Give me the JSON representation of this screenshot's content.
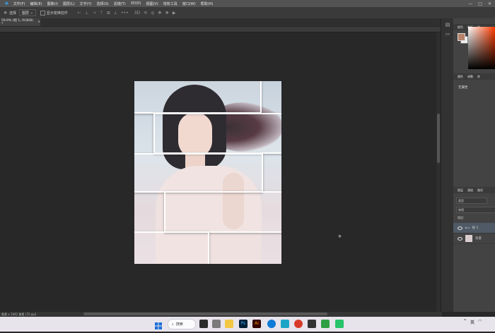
{
  "menu": {
    "items": [
      "文件(F)",
      "编辑(E)",
      "图像(I)",
      "图层(L)",
      "文字(Y)",
      "选择(S)",
      "滤镜(T)",
      "3D(D)",
      "视图(V)",
      "增效工具",
      "窗口(W)",
      "帮助(H)"
    ],
    "window_controls": [
      "—",
      "□",
      "✕"
    ]
  },
  "options": {
    "select_label": "选择",
    "layer_dropdown": "图层",
    "show_transform": "显示变换控件",
    "more": "•••"
  },
  "document": {
    "tab_title": "59.6% (组 1, RGB/8) *",
    "tab_close": "×"
  },
  "status": {
    "text": "像素 x 1042 像素 (72 ppi)"
  },
  "panels": {
    "color_tabs": [
      "颜色",
      "色板",
      "渐"
    ],
    "props_tabs": [
      "属性",
      "调整",
      "库"
    ],
    "props_empty": "无属性",
    "layers_tabs": [
      "图层",
      "通道",
      "路径"
    ],
    "kind_label": "类型",
    "blend_mode": "穿透",
    "lock_label": "锁定:",
    "layers": [
      {
        "name": "组 1",
        "selected": true
      },
      {
        "name": "背景",
        "selected": false
      }
    ]
  },
  "taskbar": {
    "search_label": "搜索",
    "tray_lang": "英",
    "colors": {
      "accent": "#1e5bd8",
      "photoshop_blue": "#31a8ff",
      "adobe_red": "#d83a2a"
    }
  }
}
